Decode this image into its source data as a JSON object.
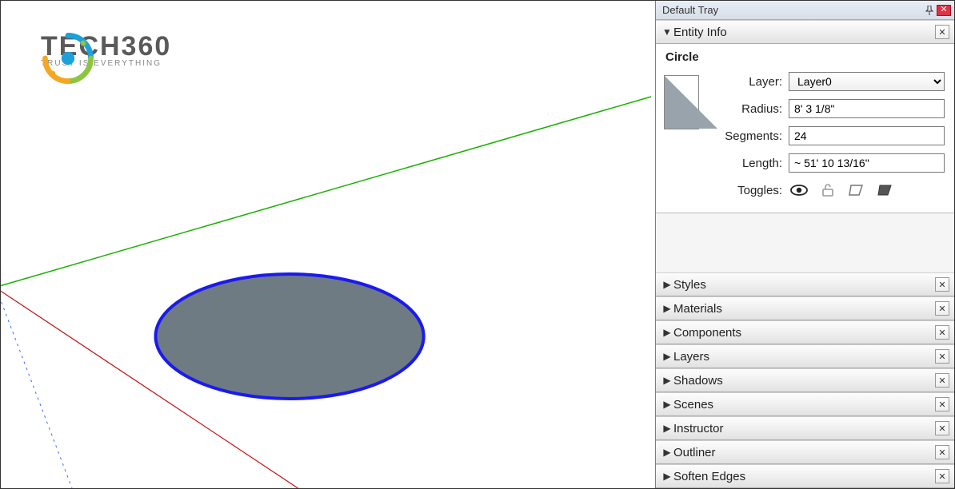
{
  "logo": {
    "brand_word": "TECH360",
    "tagline": "TRUST IS EVERYTHING"
  },
  "tray": {
    "title": "Default Tray",
    "entity_info": {
      "header": "Entity Info",
      "entity_type": "Circle",
      "layer_label": "Layer:",
      "layer_value": "Layer0",
      "radius_label": "Radius:",
      "radius_value": "8' 3 1/8\"",
      "segments_label": "Segments:",
      "segments_value": "24",
      "length_label": "Length:",
      "length_value": "~ 51' 10 13/16\"",
      "toggles_label": "Toggles:"
    },
    "collapsed_panels": [
      {
        "label": "Styles"
      },
      {
        "label": "Materials"
      },
      {
        "label": "Components"
      },
      {
        "label": "Layers"
      },
      {
        "label": "Shadows"
      },
      {
        "label": "Scenes"
      },
      {
        "label": "Instructor"
      },
      {
        "label": "Outliner"
      },
      {
        "label": "Soften Edges"
      }
    ]
  }
}
